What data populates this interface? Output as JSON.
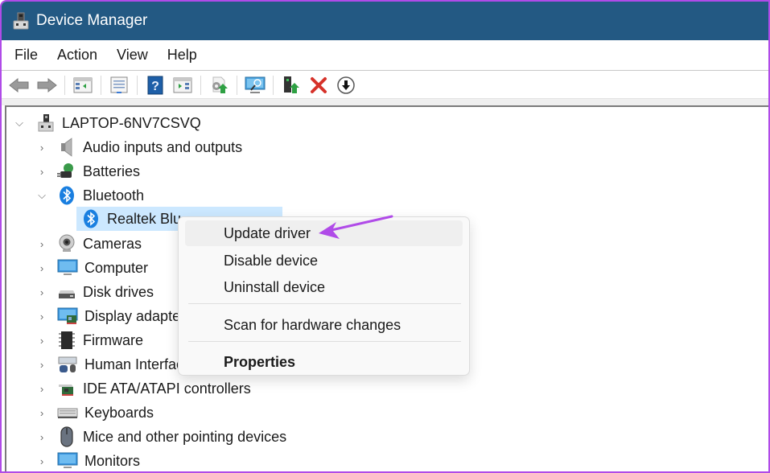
{
  "window": {
    "title": "Device Manager",
    "title_icon": "device-manager-icon",
    "titlebar_color": "#235983"
  },
  "menubar": {
    "items": [
      {
        "label": "File"
      },
      {
        "label": "Action"
      },
      {
        "label": "View"
      },
      {
        "label": "Help"
      }
    ]
  },
  "toolbar": {
    "buttons": [
      {
        "name": "back",
        "icon": "arrow-left-icon"
      },
      {
        "name": "forward",
        "icon": "arrow-right-icon"
      },
      {
        "name": "show-hide-console-tree",
        "icon": "console-tree-icon"
      },
      {
        "name": "properties",
        "icon": "properties-icon"
      },
      {
        "name": "help",
        "icon": "help-icon"
      },
      {
        "name": "show-hide-action-pane",
        "icon": "action-pane-icon"
      },
      {
        "name": "update-driver",
        "icon": "update-driver-icon"
      },
      {
        "name": "scan-hardware",
        "icon": "scan-hardware-icon"
      },
      {
        "name": "enable-device",
        "icon": "enable-device-icon"
      },
      {
        "name": "uninstall-device",
        "icon": "uninstall-x-icon"
      },
      {
        "name": "disable-device",
        "icon": "disable-down-arrow-icon"
      }
    ]
  },
  "tree": {
    "root": {
      "label": "LAPTOP-6NV7CSVQ",
      "expanded": true,
      "icon": "computer-root-icon"
    },
    "categories": [
      {
        "label": "Audio inputs and outputs",
        "icon": "speaker-icon",
        "expanded": false
      },
      {
        "label": "Batteries",
        "icon": "battery-icon",
        "expanded": false
      },
      {
        "label": "Bluetooth",
        "icon": "bluetooth-icon",
        "expanded": true,
        "children": [
          {
            "label": "Realtek Bluetooth Adapter",
            "visible_label": "Realtek Blu",
            "icon": "bluetooth-icon",
            "selected": true
          }
        ]
      },
      {
        "label": "Cameras",
        "icon": "camera-icon",
        "expanded": false
      },
      {
        "label": "Computer",
        "icon": "monitor-icon",
        "expanded": false
      },
      {
        "label": "Disk drives",
        "icon": "disk-drive-icon",
        "expanded": false
      },
      {
        "label": "Display adapte",
        "icon": "display-adapter-icon",
        "expanded": false
      },
      {
        "label": "Firmware",
        "icon": "chip-icon",
        "expanded": false
      },
      {
        "label": "Human Interfac",
        "icon": "hid-icon",
        "expanded": false
      },
      {
        "label": "IDE ATA/ATAPI controllers",
        "icon": "ide-controller-icon",
        "expanded": false
      },
      {
        "label": "Keyboards",
        "icon": "keyboard-icon",
        "expanded": false
      },
      {
        "label": "Mice and other pointing devices",
        "icon": "mouse-icon",
        "expanded": false
      },
      {
        "label": "Monitors",
        "icon": "monitor-icon",
        "expanded": false
      }
    ]
  },
  "context_menu": {
    "items": [
      {
        "label": "Update driver",
        "hovered": true
      },
      {
        "label": "Disable device"
      },
      {
        "label": "Uninstall device"
      },
      {
        "separator": true
      },
      {
        "label": "Scan for hardware changes"
      },
      {
        "separator": true
      },
      {
        "label": "Properties",
        "bold": true
      }
    ]
  },
  "annotation": {
    "type": "arrow",
    "points_to": "Update driver",
    "color": "#b04be8"
  }
}
